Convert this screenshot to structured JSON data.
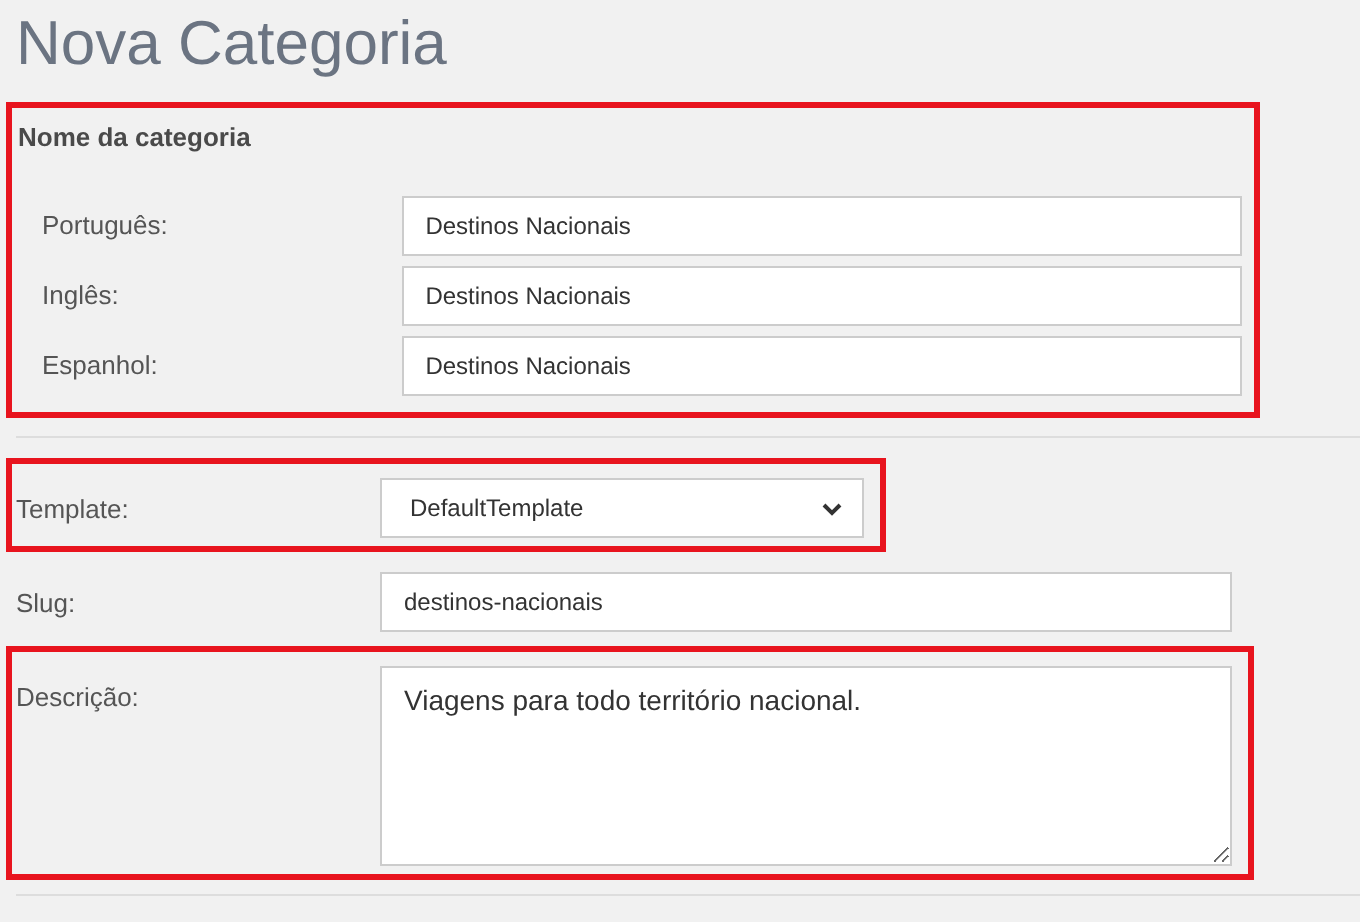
{
  "page": {
    "title": "Nova Categoria"
  },
  "name_section": {
    "heading": "Nome da categoria",
    "highlighted": true,
    "fields": [
      {
        "label": "Português:",
        "value": "Destinos Nacionais"
      },
      {
        "label": "Inglês:",
        "value": "Destinos Nacionais"
      },
      {
        "label": "Espanhol:",
        "value": "Destinos Nacionais"
      }
    ]
  },
  "fields": [
    {
      "kind": "select",
      "label": "Template:",
      "value": "DefaultTemplate",
      "highlighted": true
    },
    {
      "kind": "text",
      "label": "Slug:",
      "value": "destinos-nacionais",
      "highlighted": false
    },
    {
      "kind": "textarea",
      "label": "Descrição:",
      "value": "Viagens para todo território nacional.",
      "highlighted": true
    }
  ]
}
